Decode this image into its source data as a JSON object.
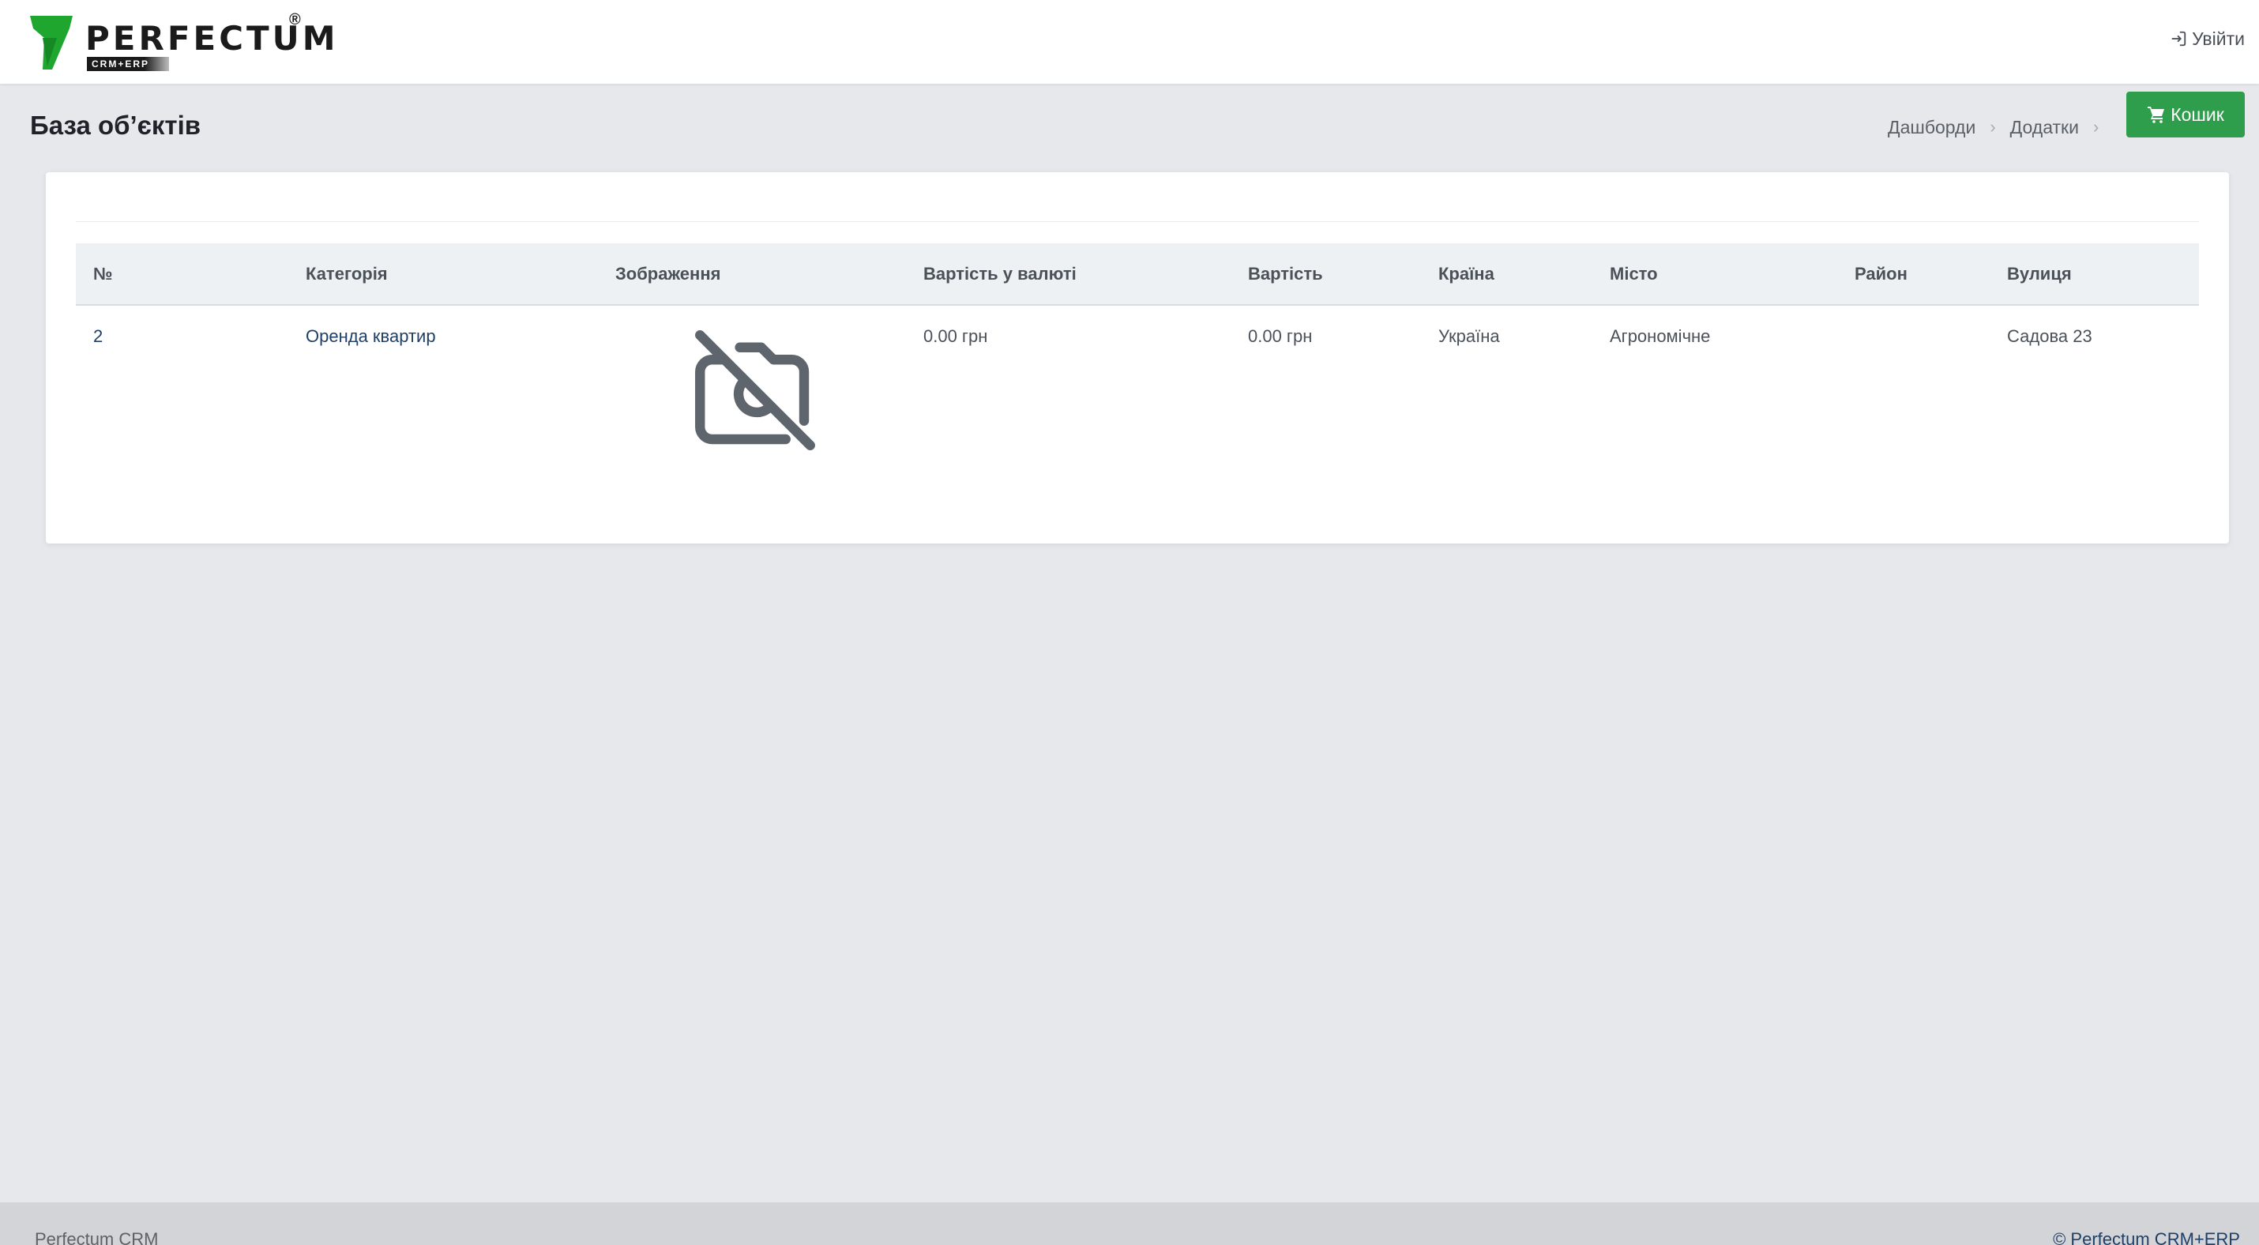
{
  "header": {
    "logo_text": "PERFECTUM",
    "logo_sub": "CRM+ERP",
    "logo_reg": "®",
    "login_label": "Увійти"
  },
  "page": {
    "title": "База об’єктів",
    "breadcrumb": [
      "Дашборди",
      "Додатки"
    ],
    "cart_label": "Кошик"
  },
  "table": {
    "columns": [
      "№",
      "Категорія",
      "Зображення",
      "Вартість у валюті",
      "Вартість",
      "Країна",
      "Місто",
      "Район",
      "Вулиця"
    ],
    "rows": [
      {
        "number": "2",
        "category": "Оренда квартир",
        "image": "no-image-icon",
        "price_currency": "0.00 грн",
        "price": "0.00 грн",
        "country": "Україна",
        "city": "Агрономічне",
        "district": "",
        "street": "Садова 23"
      }
    ]
  },
  "footer": {
    "left": "Perfectum CRM",
    "right": "© Perfectum CRM+ERP"
  },
  "colors": {
    "brand_green": "#1fa62f",
    "cart_button": "#2f9e4c",
    "link": "#1f3f66",
    "background": "#e6e8ec"
  },
  "icons": {
    "login": "sign-in-icon",
    "cart": "shopping-cart-icon",
    "breadcrumb_separator": "chevron-right-icon",
    "image_placeholder": "camera-off-icon"
  }
}
